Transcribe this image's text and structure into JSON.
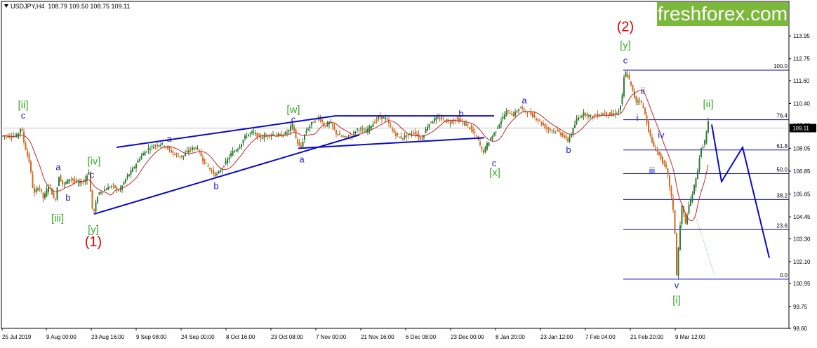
{
  "header": {
    "symbol": "USDJPY,H4",
    "ohlc": "108.79 109.50 108.75 109.11"
  },
  "brand": {
    "name": "freshforex.com",
    "color": "#7cb83b"
  },
  "colors": {
    "candle_up": "#2e7d32",
    "candle_down": "#d2691e",
    "ma": "#c62828",
    "lines": "#0a0acd",
    "green_labels": "#3aab2a",
    "red_labels": "#e00000",
    "blue_labels": "#1a1acc"
  },
  "current_price": "109.11",
  "chart_data": {
    "type": "candlestick",
    "ylim": [
      98.6,
      115.5
    ],
    "price_axis_ticks": [
      "113.95",
      "112.75",
      "111.60",
      "110.40",
      "109.25",
      "108.05",
      "106.85",
      "105.65",
      "104.45",
      "103.30",
      "102.10",
      "100.95",
      "99.75",
      "98.60"
    ],
    "time_axis_ticks": [
      "25 Jul 2019",
      "9 Aug 00:00",
      "23 Aug 16:00",
      "9 Sep 08:00",
      "24 Sep 00:00",
      "8 Oct 16:00",
      "23 Oct 08:00",
      "7 Nov 00:00",
      "21 Nov 16:00",
      "6 Dec 08:00",
      "23 Dec 00:00",
      "8 Jan 20:00",
      "23 Jan 12:00",
      "7 Feb 04:00",
      "21 Feb 20:00",
      "9 Mar 12:00"
    ],
    "price_path": [
      [
        25,
        108.7
      ],
      [
        30,
        109.2
      ],
      [
        35,
        108.2
      ],
      [
        42,
        107.3
      ],
      [
        48,
        105.6
      ],
      [
        55,
        106.1
      ],
      [
        62,
        105.4
      ],
      [
        70,
        106.2
      ],
      [
        78,
        105.2
      ],
      [
        84,
        106.6
      ],
      [
        90,
        106.1
      ],
      [
        100,
        106.5
      ],
      [
        110,
        106.2
      ],
      [
        120,
        106.3
      ],
      [
        127,
        106.9
      ],
      [
        130,
        105.2
      ],
      [
        133,
        104.6
      ],
      [
        140,
        105.7
      ],
      [
        150,
        105.9
      ],
      [
        160,
        106.1
      ],
      [
        170,
        105.8
      ],
      [
        180,
        106.5
      ],
      [
        190,
        107.0
      ],
      [
        200,
        107.6
      ],
      [
        210,
        108.0
      ],
      [
        220,
        108.2
      ],
      [
        230,
        108.3
      ],
      [
        240,
        108.0
      ],
      [
        250,
        107.7
      ],
      [
        260,
        107.6
      ],
      [
        270,
        108.0
      ],
      [
        280,
        108.1
      ],
      [
        290,
        107.4
      ],
      [
        300,
        106.9
      ],
      [
        308,
        106.6
      ],
      [
        318,
        107.1
      ],
      [
        330,
        107.8
      ],
      [
        340,
        108.1
      ],
      [
        350,
        108.7
      ],
      [
        360,
        108.9
      ],
      [
        370,
        108.6
      ],
      [
        380,
        108.7
      ],
      [
        390,
        108.8
      ],
      [
        400,
        108.7
      ],
      [
        410,
        108.9
      ],
      [
        417,
        109.3
      ],
      [
        422,
        108.5
      ],
      [
        428,
        108.0
      ],
      [
        435,
        108.9
      ],
      [
        445,
        109.4
      ],
      [
        455,
        109.7
      ],
      [
        462,
        109.2
      ],
      [
        470,
        109.4
      ],
      [
        480,
        108.8
      ],
      [
        490,
        108.6
      ],
      [
        500,
        108.7
      ],
      [
        510,
        109.1
      ],
      [
        520,
        108.9
      ],
      [
        530,
        109.3
      ],
      [
        540,
        109.7
      ],
      [
        550,
        109.6
      ],
      [
        560,
        108.9
      ],
      [
        570,
        108.6
      ],
      [
        580,
        108.7
      ],
      [
        590,
        108.9
      ],
      [
        600,
        108.5
      ],
      [
        610,
        109.3
      ],
      [
        620,
        109.6
      ],
      [
        630,
        109.6
      ],
      [
        640,
        109.4
      ],
      [
        650,
        109.6
      ],
      [
        660,
        109.4
      ],
      [
        670,
        109.1
      ],
      [
        680,
        108.6
      ],
      [
        688,
        107.8
      ],
      [
        696,
        108.4
      ],
      [
        705,
        108.9
      ],
      [
        712,
        109.4
      ],
      [
        722,
        110.0
      ],
      [
        732,
        109.8
      ],
      [
        740,
        110.2
      ],
      [
        748,
        110.0
      ],
      [
        758,
        109.8
      ],
      [
        768,
        109.5
      ],
      [
        778,
        109.1
      ],
      [
        788,
        109.0
      ],
      [
        796,
        108.9
      ],
      [
        803,
        108.7
      ],
      [
        808,
        108.4
      ],
      [
        815,
        108.9
      ],
      [
        822,
        109.6
      ],
      [
        832,
        109.9
      ],
      [
        842,
        109.7
      ],
      [
        852,
        109.8
      ],
      [
        862,
        109.9
      ],
      [
        872,
        109.8
      ],
      [
        882,
        110.0
      ],
      [
        886,
        110.6
      ],
      [
        890,
        112.1
      ],
      [
        895,
        111.8
      ],
      [
        900,
        111.2
      ],
      [
        906,
        110.5
      ],
      [
        912,
        110.6
      ],
      [
        918,
        110.0
      ],
      [
        924,
        109.0
      ],
      [
        930,
        108.2
      ],
      [
        936,
        107.9
      ],
      [
        942,
        107.5
      ],
      [
        950,
        106.9
      ],
      [
        957,
        105.4
      ],
      [
        961,
        104.1
      ],
      [
        964,
        101.4
      ],
      [
        968,
        103.6
      ],
      [
        972,
        105.2
      ],
      [
        976,
        104.0
      ],
      [
        980,
        104.8
      ],
      [
        986,
        105.6
      ],
      [
        992,
        106.5
      ],
      [
        998,
        107.9
      ],
      [
        1004,
        108.4
      ],
      [
        1009,
        109.4
      ]
    ],
    "fibonacci_levels": [
      {
        "label": "100.0",
        "price": 112.15
      },
      {
        "label": "76.4",
        "price": 109.55
      },
      {
        "label": "61.8",
        "price": 107.96
      },
      {
        "label": "50.0",
        "price": 106.72
      },
      {
        "label": "38.2",
        "price": 105.36
      },
      {
        "label": "23.6",
        "price": 103.78
      },
      {
        "label": "0.0",
        "price": 101.18
      }
    ],
    "wave_labels": [
      {
        "text": "[ii]",
        "x": 33,
        "price": 110.15,
        "color": "green"
      },
      {
        "text": "c",
        "x": 33,
        "price": 109.6,
        "color": "blue"
      },
      {
        "text": "a",
        "x": 83,
        "price": 106.9,
        "color": "blue"
      },
      {
        "text": "b",
        "x": 97,
        "price": 105.3,
        "color": "blue"
      },
      {
        "text": "[iii]",
        "x": 82,
        "price": 104.2,
        "color": "green"
      },
      {
        "text": "[iv]",
        "x": 134,
        "price": 107.2,
        "color": "green"
      },
      {
        "text": "c",
        "x": 131,
        "price": 106.5,
        "color": "blue"
      },
      {
        "text": "[y]",
        "x": 133,
        "price": 103.6,
        "color": "green"
      },
      {
        "text": "(1)",
        "x": 133,
        "price": 102.9,
        "color": "red"
      },
      {
        "text": "a",
        "x": 241,
        "price": 108.4,
        "color": "blue"
      },
      {
        "text": "b",
        "x": 308,
        "price": 105.9,
        "color": "blue"
      },
      {
        "text": "[w]",
        "x": 418,
        "price": 109.9,
        "color": "green"
      },
      {
        "text": "c",
        "x": 418,
        "price": 109.4,
        "color": "blue"
      },
      {
        "text": "a",
        "x": 430,
        "price": 107.3,
        "color": "blue"
      },
      {
        "text": "b",
        "x": 657,
        "price": 109.7,
        "color": "blue"
      },
      {
        "text": "c",
        "x": 704,
        "price": 107.1,
        "color": "blue"
      },
      {
        "text": "[x]",
        "x": 705,
        "price": 106.6,
        "color": "green"
      },
      {
        "text": "a",
        "x": 747,
        "price": 110.4,
        "color": "blue"
      },
      {
        "text": "b",
        "x": 810,
        "price": 107.8,
        "color": "blue"
      },
      {
        "text": "(2)",
        "x": 891,
        "price": 114.2,
        "color": "red"
      },
      {
        "text": "[y]",
        "x": 891,
        "price": 113.3,
        "color": "green"
      },
      {
        "text": "c",
        "x": 891,
        "price": 112.5,
        "color": "blue"
      },
      {
        "text": "ii",
        "x": 916,
        "price": 110.9,
        "color": "blue"
      },
      {
        "text": "i",
        "x": 908,
        "price": 109.5,
        "color": "blue"
      },
      {
        "text": "iv",
        "x": 942,
        "price": 108.6,
        "color": "blue"
      },
      {
        "text": "iii",
        "x": 929,
        "price": 106.7,
        "color": "blue"
      },
      {
        "text": "[ii]",
        "x": 1009,
        "price": 110.2,
        "color": "green"
      },
      {
        "text": "v",
        "x": 964,
        "price": 100.7,
        "color": "blue"
      },
      {
        "text": "[i]",
        "x": 964,
        "price": 99.9,
        "color": "green"
      }
    ],
    "trend_lines": [
      {
        "x1": 166,
        "p1": 108.1,
        "x2": 478,
        "p2": 109.75
      },
      {
        "x1": 134,
        "p1": 104.6,
        "x2": 512,
        "p2": 108.75
      },
      {
        "x1": 425,
        "p1": 108.05,
        "x2": 690,
        "p2": 108.6
      },
      {
        "x1": 478,
        "p1": 109.75,
        "x2": 704,
        "p2": 109.75
      }
    ],
    "forecast_path": [
      [
        1014,
        109.3
      ],
      [
        1028,
        106.3
      ],
      [
        1058,
        108.1
      ],
      [
        1096,
        102.3
      ]
    ]
  }
}
